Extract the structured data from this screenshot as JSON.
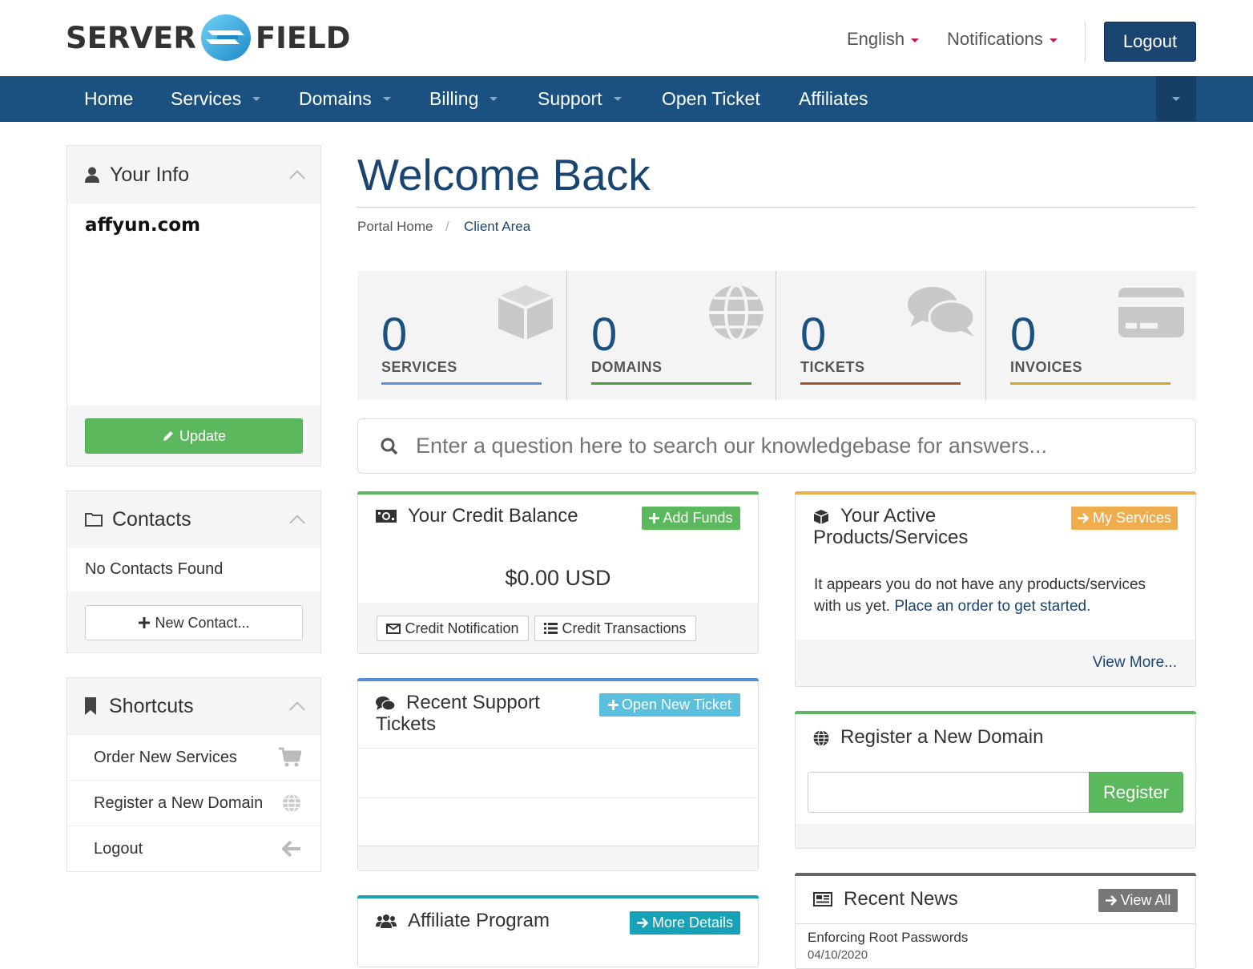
{
  "header": {
    "logo_left": "SERVER",
    "logo_right": "FIELD",
    "language": "English",
    "notifications": "Notifications",
    "logout": "Logout"
  },
  "nav": {
    "items": [
      {
        "label": "Home",
        "dropdown": false
      },
      {
        "label": "Services",
        "dropdown": true
      },
      {
        "label": "Domains",
        "dropdown": true
      },
      {
        "label": "Billing",
        "dropdown": true
      },
      {
        "label": "Support",
        "dropdown": true
      },
      {
        "label": "Open Ticket",
        "dropdown": false
      },
      {
        "label": "Affiliates",
        "dropdown": false
      }
    ]
  },
  "sidebar": {
    "your_info": {
      "title": "Your Info",
      "name": "affyun.com",
      "update": "Update"
    },
    "contacts": {
      "title": "Contacts",
      "empty": "No Contacts Found",
      "new": "New Contact..."
    },
    "shortcuts": {
      "title": "Shortcuts",
      "items": [
        {
          "label": "Order New Services",
          "icon": "cart-icon"
        },
        {
          "label": "Register a New Domain",
          "icon": "globe-icon"
        },
        {
          "label": "Logout",
          "icon": "arrow-left-icon"
        }
      ]
    }
  },
  "main": {
    "title": "Welcome Back",
    "breadcrumb": {
      "home": "Portal Home",
      "sep": "/",
      "current": "Client Area"
    },
    "stats": [
      {
        "value": "0",
        "label": "SERVICES",
        "color": "#5b8fd6",
        "icon": "cube-icon"
      },
      {
        "value": "0",
        "label": "DOMAINS",
        "color": "#4a9a3c",
        "icon": "globe-icon"
      },
      {
        "value": "0",
        "label": "TICKETS",
        "color": "#a0522d",
        "icon": "comments-icon"
      },
      {
        "value": "0",
        "label": "INVOICES",
        "color": "#d4a72c",
        "icon": "credit-card-icon"
      }
    ],
    "search": {
      "placeholder": "Enter a question here to search our knowledgebase for answers..."
    },
    "credit": {
      "title": "Your Credit Balance",
      "add_funds": "Add Funds",
      "balance": "$0.00 USD",
      "notification": "Credit Notification",
      "transactions": "Credit Transactions"
    },
    "products": {
      "title_line1": "Your Active",
      "title_line2": "Products/Services",
      "button": "My Services",
      "text": "It appears you do not have any products/services with us yet.",
      "link": "Place an order to get started.",
      "view_more": "View More..."
    },
    "tickets": {
      "title_line1": "Recent Support",
      "title_line2": "Tickets",
      "button": "Open New Ticket"
    },
    "register_domain": {
      "title": "Register a New Domain",
      "button": "Register",
      "input_value": ""
    },
    "affiliate": {
      "title": "Affiliate Program",
      "button": "More Details"
    },
    "news": {
      "title": "Recent News",
      "button": "View All",
      "items": [
        {
          "title": "Enforcing Root Passwords",
          "date": "04/10/2020"
        }
      ]
    }
  },
  "colors": {
    "brand": "#1a4570",
    "nav": "#1a5181",
    "green": "#5cb85c",
    "warning": "#f0ad4e",
    "info": "#5bc0de",
    "teal": "#17a2b8",
    "grey": "#777777"
  }
}
